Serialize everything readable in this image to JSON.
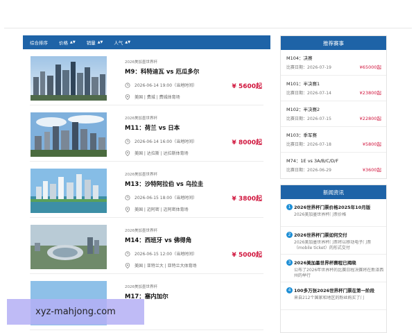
{
  "sortbar": {
    "items": [
      {
        "label": "综合排序",
        "arrow": ""
      },
      {
        "label": "价格",
        "arrow": "▲▼"
      },
      {
        "label": "销量",
        "arrow": "▲▼"
      },
      {
        "label": "人气",
        "arrow": "▲▼"
      }
    ]
  },
  "matches": [
    {
      "league": "2026美加墨世界杯",
      "title": "M9：科特迪瓦 vs 厄瓜多尔",
      "time": "2026-06-14 19:00（当地时间）",
      "venue": "美国 | 费城 | 费城体育场",
      "price": "¥ 5600起"
    },
    {
      "league": "2026美加墨世界杯",
      "title": "M11：荷兰 vs 日本",
      "time": "2026-06-14 16:00（当地时间）",
      "venue": "美国 | 达拉斯 | 达拉斯体育场",
      "price": "¥ 8000起"
    },
    {
      "league": "2026美加墨世界杯",
      "title": "M13：沙特阿拉伯 vs 乌拉圭",
      "time": "2026-06-15 18:00（当地时间）",
      "venue": "美国 | 迈阿密 | 迈阿密体育场",
      "price": "¥ 3800起"
    },
    {
      "league": "2026美加墨世界杯",
      "title": "M14：西班牙 vs 佛得角",
      "time": "2026-06-15 12:00（当地时间）",
      "venue": "美国 | 亚特兰大 | 亚特兰大体育场",
      "price": "¥ 5000起"
    },
    {
      "league": "2026美加墨世界杯",
      "title": "M17：塞内加尔",
      "time": "",
      "venue": "",
      "price": ""
    }
  ],
  "recommend": {
    "title": "推荐赛事",
    "date_prefix": "比赛日期：",
    "items": [
      {
        "name": "M104：决赛",
        "date": "2026-07-19",
        "price": "¥65000起"
      },
      {
        "name": "M101：半决赛1",
        "date": "2026-07-14",
        "price": "¥23800起"
      },
      {
        "name": "M102：半决赛2",
        "date": "2026-07-15",
        "price": "¥22800起"
      },
      {
        "name": "M103：季军赛",
        "date": "2026-07-18",
        "price": "¥5800起"
      },
      {
        "name": "M74：1E vs 3A/B/C/D/F",
        "date": "2026-06-29",
        "price": "¥3600起"
      }
    ]
  },
  "news": {
    "title": "新闻资讯",
    "items": [
      {
        "num": "1",
        "title": "2026世界杯门票价格2025年10月版",
        "desc": "2026美加墨世界杯门票价格"
      },
      {
        "num": "2",
        "title": "2026世界杯门票如何交付",
        "desc": "2026美加墨世界杯门票将以移动电子门票（mobile ticket）的形式交付"
      },
      {
        "num": "3",
        "title": "2026美加墨世界杯赛程已揭晓",
        "desc": "公布了2026年世界杯的比赛日程决赛将在新泽西州的举行"
      },
      {
        "num": "4",
        "title": "100多万张2026世界杯门票在第一阶段",
        "desc": "来自212个国家和地区的粉丝购买了门"
      }
    ]
  },
  "watermark": "xyz-mahjong.com",
  "colors": {
    "accent": "#1e63a7",
    "price": "#d0143c",
    "badge": "#1e8fd6"
  }
}
